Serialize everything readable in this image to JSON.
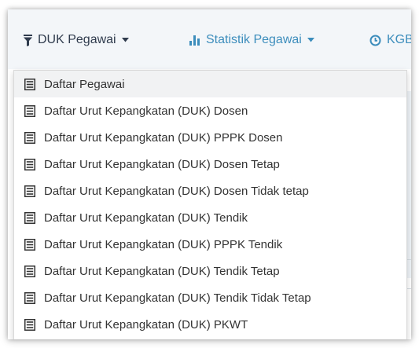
{
  "nav": {
    "items": [
      {
        "label": "DUK Pegawai",
        "icon": "filter-icon",
        "color": "#2f3b4d"
      },
      {
        "label": "Statistik Pegawai",
        "icon": "bar-chart-icon",
        "color": "#3c8dbc"
      },
      {
        "label": "KGB",
        "icon": "clock-icon",
        "color": "#3c8dbc"
      }
    ]
  },
  "dropdown": {
    "active_index": 0,
    "items": [
      {
        "label": "Daftar Pegawai",
        "icon": "document-list-icon"
      },
      {
        "label": "Daftar Urut Kepangkatan (DUK) Dosen",
        "icon": "document-list-icon"
      },
      {
        "label": "Daftar Urut Kepangkatan (DUK) PPPK Dosen",
        "icon": "document-list-icon"
      },
      {
        "label": "Daftar Urut Kepangkatan (DUK) Dosen Tetap",
        "icon": "document-list-icon"
      },
      {
        "label": "Daftar Urut Kepangkatan (DUK) Dosen Tidak tetap",
        "icon": "document-list-icon"
      },
      {
        "label": "Daftar Urut Kepangkatan (DUK) Tendik",
        "icon": "document-list-icon"
      },
      {
        "label": "Daftar Urut Kepangkatan (DUK) PPPK Tendik",
        "icon": "document-list-icon"
      },
      {
        "label": "Daftar Urut Kepangkatan (DUK) Tendik Tetap",
        "icon": "document-list-icon"
      },
      {
        "label": "Daftar Urut Kepangkatan (DUK) Tendik Tidak Tetap",
        "icon": "document-list-icon"
      },
      {
        "label": "Daftar Urut Kepangkatan (DUK) PKWT",
        "icon": "document-list-icon"
      }
    ]
  },
  "colors": {
    "navbar_bg": "#f3f6f9",
    "link_blue": "#3c8dbc",
    "text_dark": "#2f3b4d",
    "active_item_bg": "#f1f2f3"
  }
}
